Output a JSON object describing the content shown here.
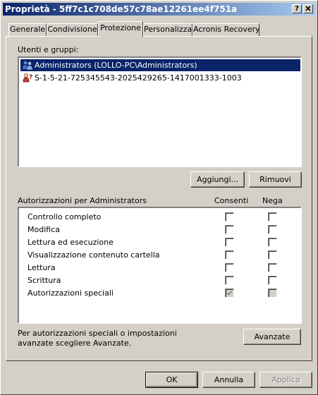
{
  "window": {
    "title": "Proprietà - 5ff7c1c708de57c78ae12261ee4f751a",
    "help_button": "?",
    "close_button": "X"
  },
  "tabs": [
    "Generale",
    "Condivisione",
    "Protezione",
    "Personalizza",
    "Acronis Recovery"
  ],
  "users_section": {
    "label": "Utenti e gruppi:",
    "items": [
      {
        "name": "Administrators (LOLLO-PC\\Administrators)",
        "icon": "group-icon",
        "selected": true
      },
      {
        "name": "S-1-5-21-725345543-2025429265-1417001333-1003",
        "icon": "unknown-user-icon",
        "selected": false
      }
    ],
    "add_button": "Aggiungi...",
    "remove_button": "Rimuovi"
  },
  "permissions": {
    "header": "Autorizzazioni per Administrators",
    "col_allow": "Consenti",
    "col_deny": "Nega",
    "rows": [
      {
        "name": "Controllo completo",
        "allow": false,
        "deny": false,
        "disabled": false
      },
      {
        "name": "Modifica",
        "allow": false,
        "deny": false,
        "disabled": false
      },
      {
        "name": "Lettura ed esecuzione",
        "allow": false,
        "deny": false,
        "disabled": false
      },
      {
        "name": "Visualizzazione contenuto cartella",
        "allow": false,
        "deny": false,
        "disabled": false
      },
      {
        "name": "Lettura",
        "allow": false,
        "deny": false,
        "disabled": false
      },
      {
        "name": "Scrittura",
        "allow": false,
        "deny": false,
        "disabled": false
      },
      {
        "name": "Autorizzazioni speciali",
        "allow": true,
        "deny": false,
        "disabled": true
      }
    ]
  },
  "advanced": {
    "note_line1": "Per autorizzazioni speciali o impostazioni",
    "note_line2": "avanzate scegliere Avanzate.",
    "button": "Avanzate"
  },
  "footer": {
    "ok": "OK",
    "cancel": "Annulla",
    "apply": "Applica"
  },
  "colors": {
    "face": "#d4d0c8",
    "titlebar_start": "#0a246a",
    "titlebar_end": "#a6caf0",
    "selection": "#0a246a"
  }
}
